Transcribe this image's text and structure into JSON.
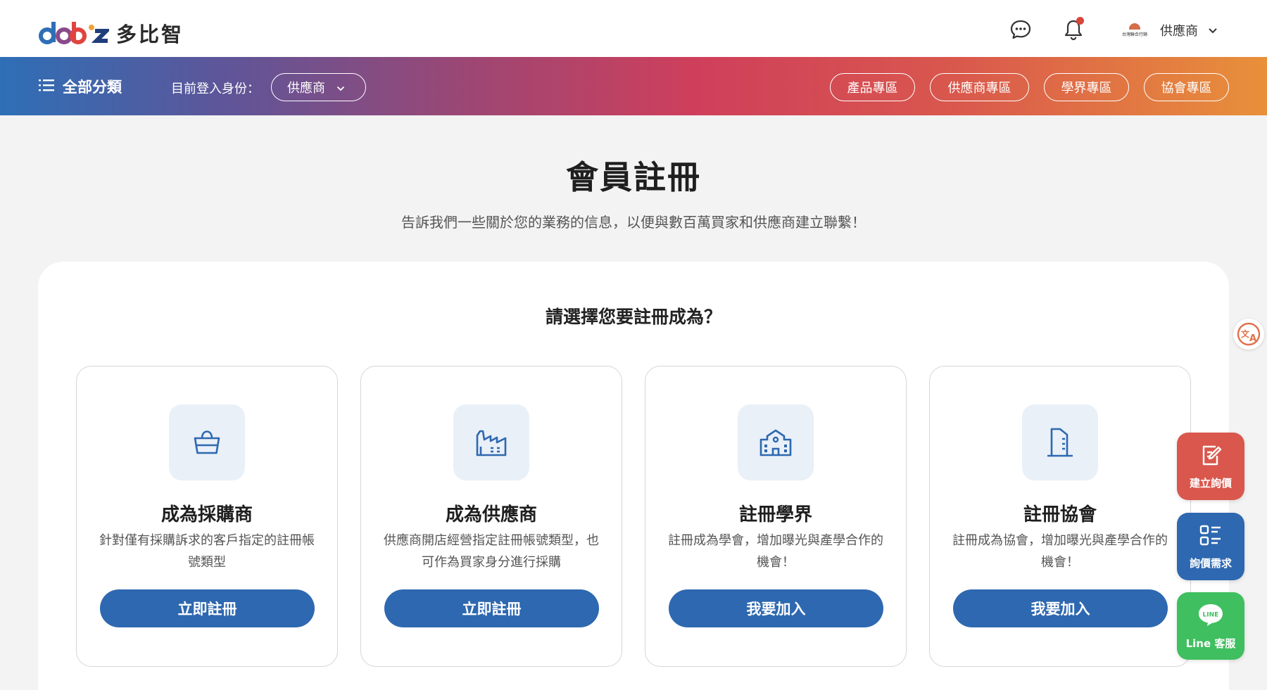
{
  "header": {
    "logo_text": "多比智",
    "account_logo_text": "台灣聯合行銷",
    "account_name": "供應商",
    "icons": [
      "chat-bubble-icon",
      "bell-icon",
      "chevron-down-icon"
    ]
  },
  "nav": {
    "all_categories": "全部分類",
    "role_label": "目前登入身份：",
    "role_value": "供應商",
    "links": [
      "產品專區",
      "供應商專區",
      "學界專區",
      "協會專區"
    ]
  },
  "page": {
    "title": "會員註冊",
    "subtitle": "告訴我們一些關於您的業務的信息，以便與數百萬買家和供應商建立聯繫！",
    "question": "請選擇您要註冊成為？"
  },
  "options": [
    {
      "icon": "shopping-basket-icon",
      "title": "成為採購商",
      "desc": "針對僅有採購訴求的客戶指定的註冊帳號類型",
      "button": "立即註冊"
    },
    {
      "icon": "factory-icon",
      "title": "成為供應商",
      "desc": "供應商開店經營指定註冊帳號類型，也可作為買家身分進行採購",
      "button": "立即註冊"
    },
    {
      "icon": "school-icon",
      "title": "註冊學界",
      "desc": "註冊成為學會，增加曝光與產學合作的機會！",
      "button": "我要加入"
    },
    {
      "icon": "building-icon",
      "title": "註冊協會",
      "desc": "註冊成為協會，增加曝光與產學合作的機會！",
      "button": "我要加入"
    }
  ],
  "floating": {
    "inquiry_create": "建立詢價",
    "inquiry_needs": "詢價需求",
    "line_service": "Line 客服",
    "line_logo_text": "LINE"
  },
  "colors": {
    "primary": "#2e68b0",
    "accent_red": "#d9453a",
    "line_green": "#3fbf5f",
    "inquiry_red": "#d9574d"
  }
}
